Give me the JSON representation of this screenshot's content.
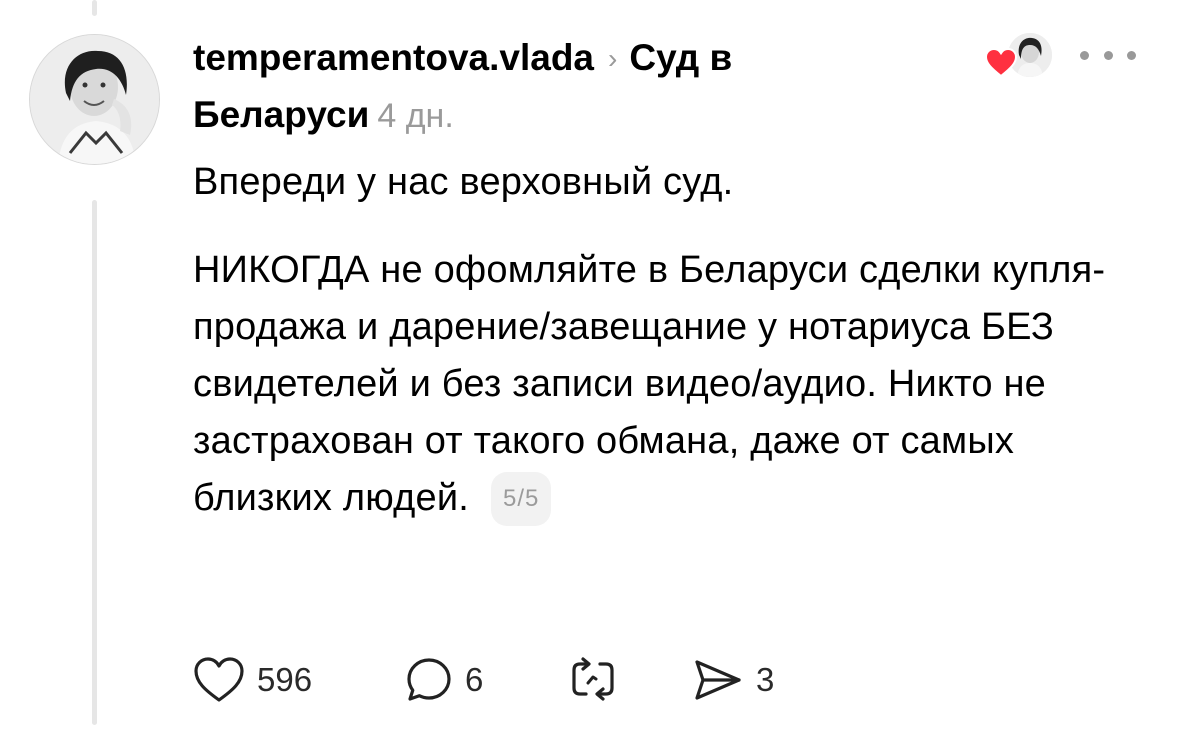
{
  "post": {
    "author": "temperamentova.vlada",
    "community": "Суд в Беларуси",
    "time_ago": "4 дн.",
    "paragraphs": [
      "Впереди у нас верховный суд.",
      "НИКОГДА не офомляйте в Беларуси сделки купля-продажа и дарение/завещание у нотариуса БЕЗ свидетелей и без записи видео/аудио. Никто не застрахован от такого обмана, даже от самых близких людей."
    ],
    "page_indicator": "5/5"
  },
  "actions": {
    "likes": "596",
    "replies": "6",
    "shares": "3"
  },
  "icons": {
    "breadcrumb": "chevron-right-icon",
    "liked_by": "heart-icon",
    "more": "more-horizontal-icon",
    "like": "heart-outline-icon",
    "reply": "comment-bubble-icon",
    "repost": "repost-icon",
    "share": "send-icon"
  },
  "colors": {
    "heart_red": "#ff3040",
    "muted_text": "#9a9a9a",
    "thread_line": "#e6e6e6"
  }
}
